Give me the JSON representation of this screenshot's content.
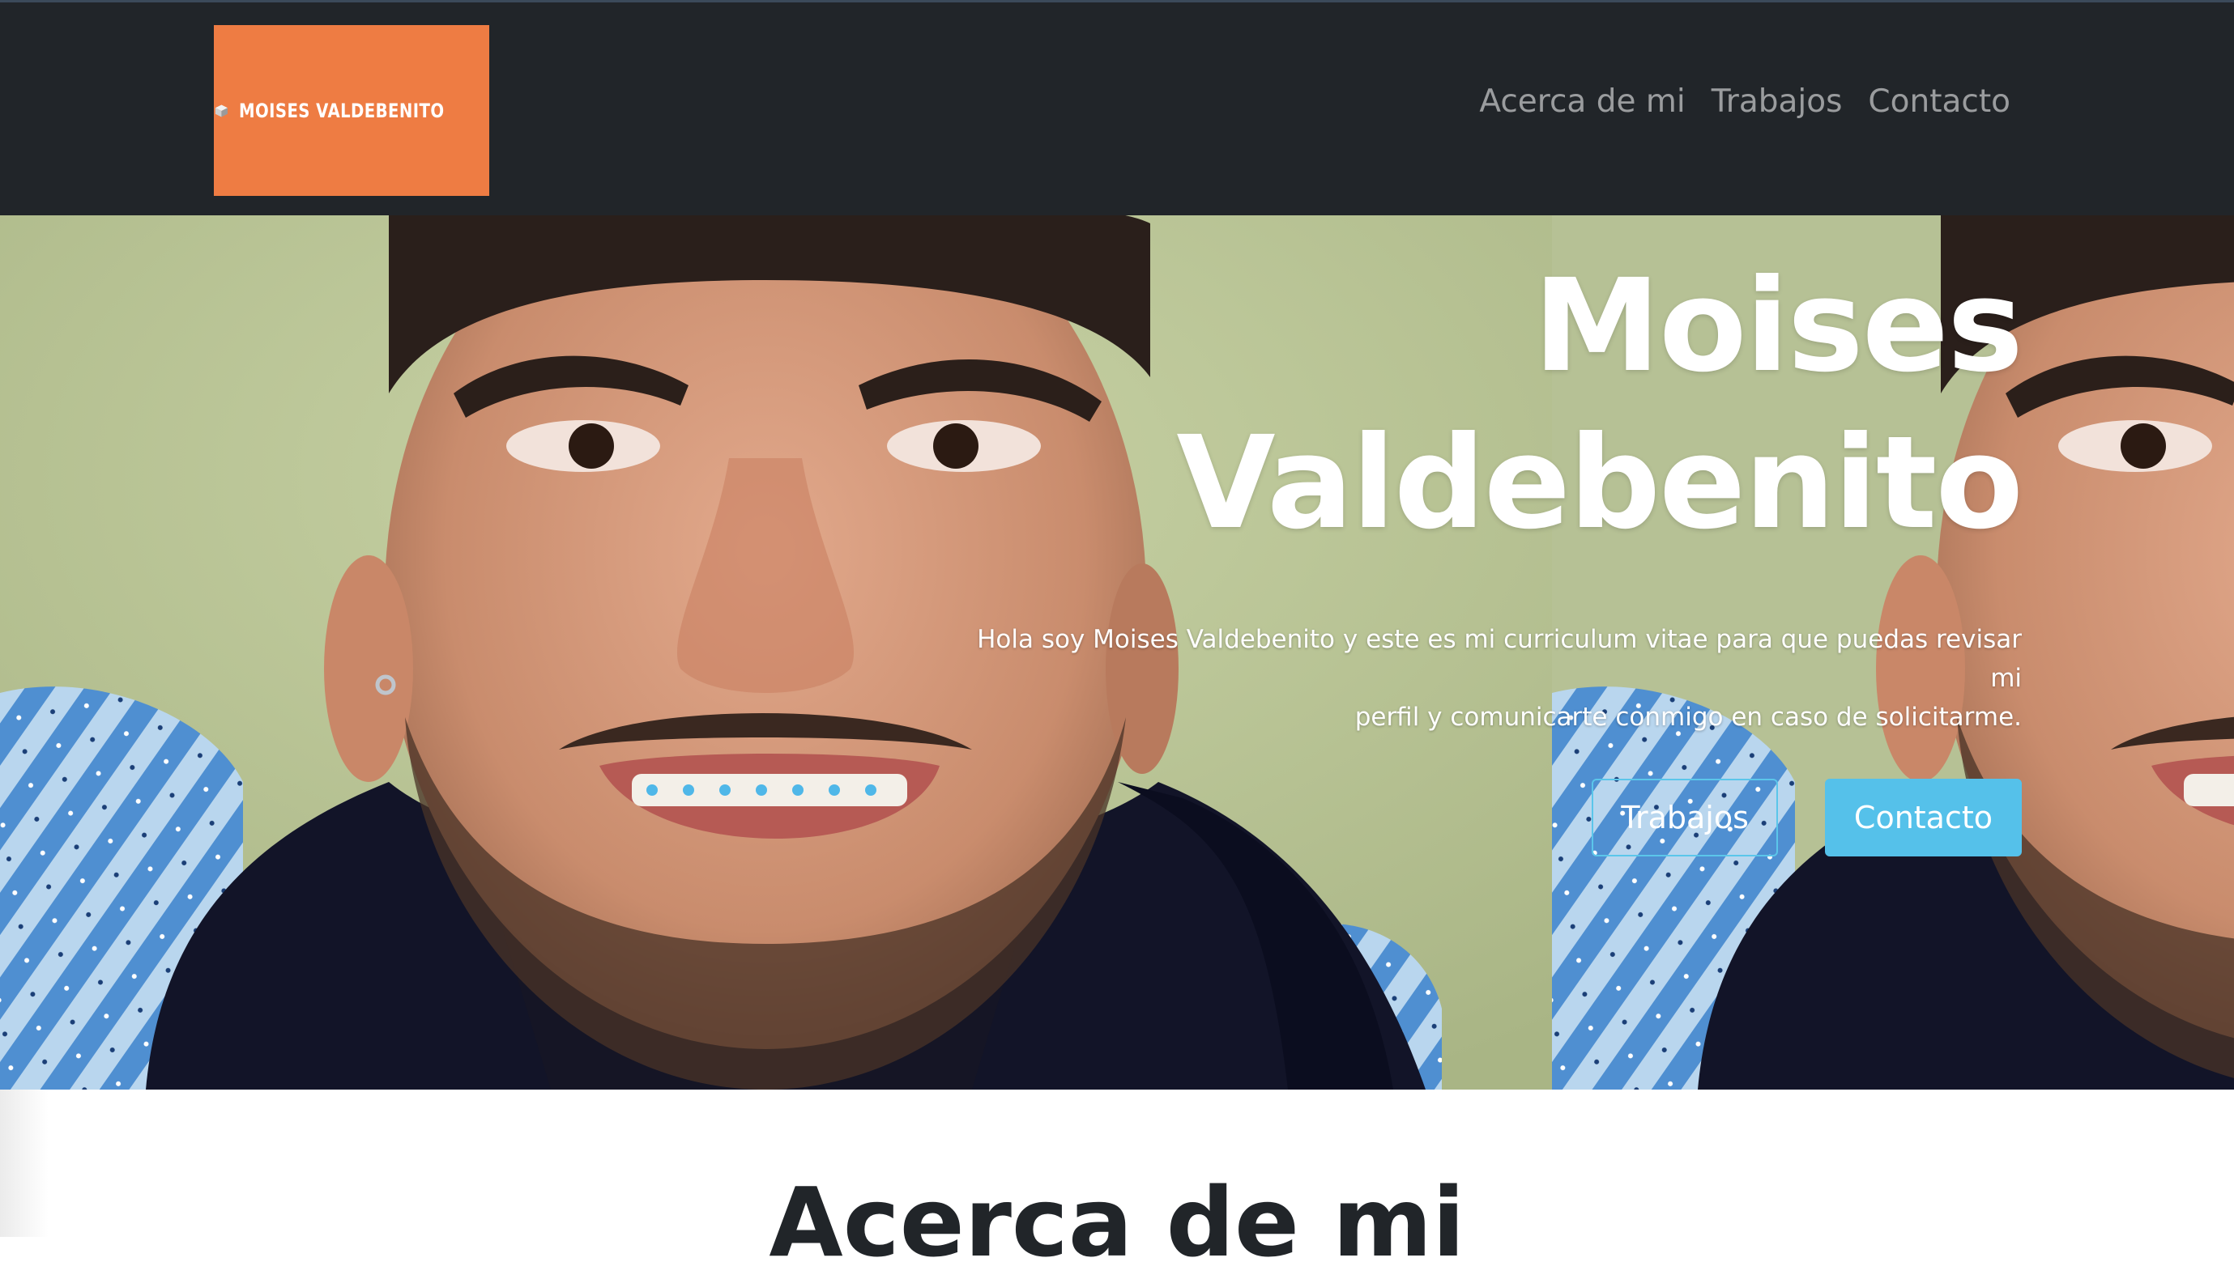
{
  "brand": {
    "logo_text": "MOISES VALDEBENITO",
    "background_color": "#ee7c43",
    "icon": "cube-icon"
  },
  "nav": {
    "items": [
      {
        "label": "Acerca de mi"
      },
      {
        "label": "Trabajos"
      },
      {
        "label": "Contacto"
      }
    ],
    "background_color": "#212529"
  },
  "hero": {
    "title_line1": "Moises",
    "title_line2": "Valdebenito",
    "intro_line1": "Hola soy Moises Valdebenito y este es mi curriculum vitae para que puedas revisar mi",
    "intro_line2": "perfil y comunicarte conmigo en caso de solicitarme.",
    "button_works": "Trabajos",
    "button_contact": "Contacto",
    "accent_color": "#55c1ea",
    "image": "portrait-photo"
  },
  "about": {
    "heading": "Acerca de mi"
  }
}
